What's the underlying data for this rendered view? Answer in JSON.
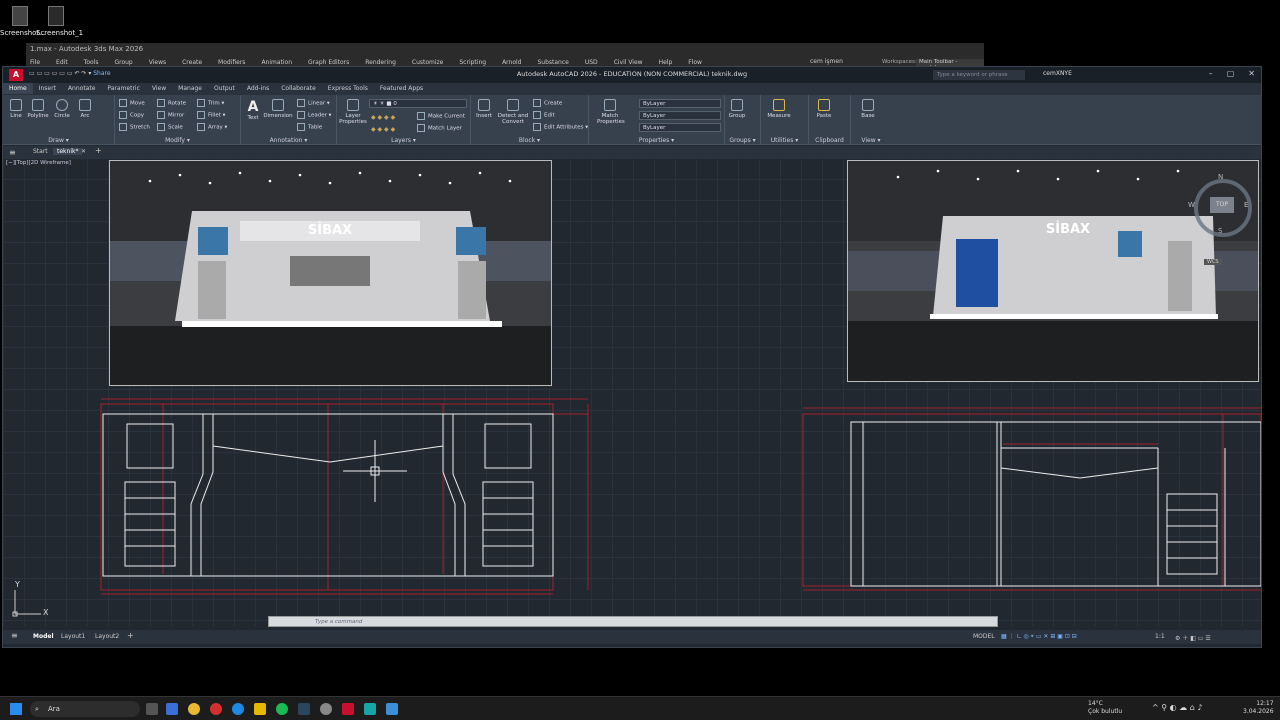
{
  "desktop": {
    "icons": [
      {
        "label": "Screenshot..."
      },
      {
        "label": "Screenshot_1"
      }
    ]
  },
  "max_window": {
    "title": "1.max - Autodesk 3ds Max 2026",
    "menu": [
      "File",
      "Edit",
      "Tools",
      "Group",
      "Views",
      "Create",
      "Modifiers",
      "Animation",
      "Graph Editors",
      "Rendering",
      "Customize",
      "Scripting",
      "Arnold",
      "Substance",
      "USD",
      "Civil View",
      "Help",
      "Flow"
    ],
    "user": "cem işmen",
    "workspace_label": "Workspaces:",
    "workspace_value": "Main Toolbar - modular"
  },
  "acad": {
    "logo": "A",
    "share": "Share",
    "title": "Autodesk AutoCAD 2026 - EDUCATION (NON COMMERCIAL)    teknik.dwg",
    "search_placeholder": "Type a keyword or phrase",
    "user": "cemXNYE",
    "ribbon_tabs": [
      "Home",
      "Insert",
      "Annotate",
      "Parametric",
      "View",
      "Manage",
      "Output",
      "Add-ins",
      "Collaborate",
      "Express Tools",
      "Featured Apps"
    ],
    "active_tab": "Home",
    "groups": {
      "draw": {
        "title": "Draw ▾",
        "big": [
          "Line",
          "Polyline",
          "Circle",
          "Arc"
        ]
      },
      "modify": {
        "title": "Modify ▾",
        "items": [
          "Move",
          "Rotate",
          "Trim ▾",
          "Copy",
          "Mirror",
          "Fillet ▾",
          "Stretch",
          "Scale",
          "Array ▾"
        ]
      },
      "annotation": {
        "title": "Annotation ▾",
        "big": [
          "Text",
          "Dimension"
        ],
        "items": [
          "Linear ▾",
          "Leader ▾",
          "Table"
        ]
      },
      "layers": {
        "title": "Layers ▾",
        "big": [
          "Layer Properties"
        ],
        "layer_value": "0",
        "items": [
          "Make Current",
          "Match Layer"
        ]
      },
      "block": {
        "title": "Block ▾",
        "big": [
          "Insert",
          "Detect and Convert"
        ],
        "items": [
          "Create",
          "Edit",
          "Edit Attributes ▾"
        ]
      },
      "properties": {
        "title": "Properties ▾",
        "big": [
          "Match Properties"
        ],
        "dropdowns": [
          "ByLayer",
          "ByLayer",
          "ByLayer"
        ]
      },
      "groups": {
        "title": "Groups ▾",
        "big": [
          "Group"
        ]
      },
      "utilities": {
        "title": "Utilities ▾",
        "big": [
          "Measure"
        ]
      },
      "clipboard": {
        "title": "Clipboard",
        "big": [
          "Paste"
        ]
      },
      "view": {
        "title": "View ▾",
        "big": [
          "Base"
        ]
      }
    },
    "file_tabs": [
      "Start",
      "teknik*"
    ],
    "viewport_label": "[−][Top][2D Wireframe]",
    "viewcube": {
      "top": "TOP",
      "n": "N",
      "s": "S",
      "e": "E",
      "w": "W",
      "wcs": "WCS"
    },
    "render_logo": "SİBAX",
    "ucs": {
      "x": "X",
      "y": "Y"
    },
    "command_placeholder": "Type a command",
    "layout_tabs": [
      "Model",
      "Layout1",
      "Layout2"
    ],
    "model_label": "MODEL",
    "scale": "1:1"
  },
  "taskbar": {
    "search": "Ara",
    "weather_temp": "14°C",
    "weather_desc": "Çok bulutlu",
    "time": "12:17",
    "date": "3.04.2026"
  },
  "colors": {
    "dim_red": "#c8202a",
    "bg": "#212830",
    "ribbon": "#37414e"
  }
}
